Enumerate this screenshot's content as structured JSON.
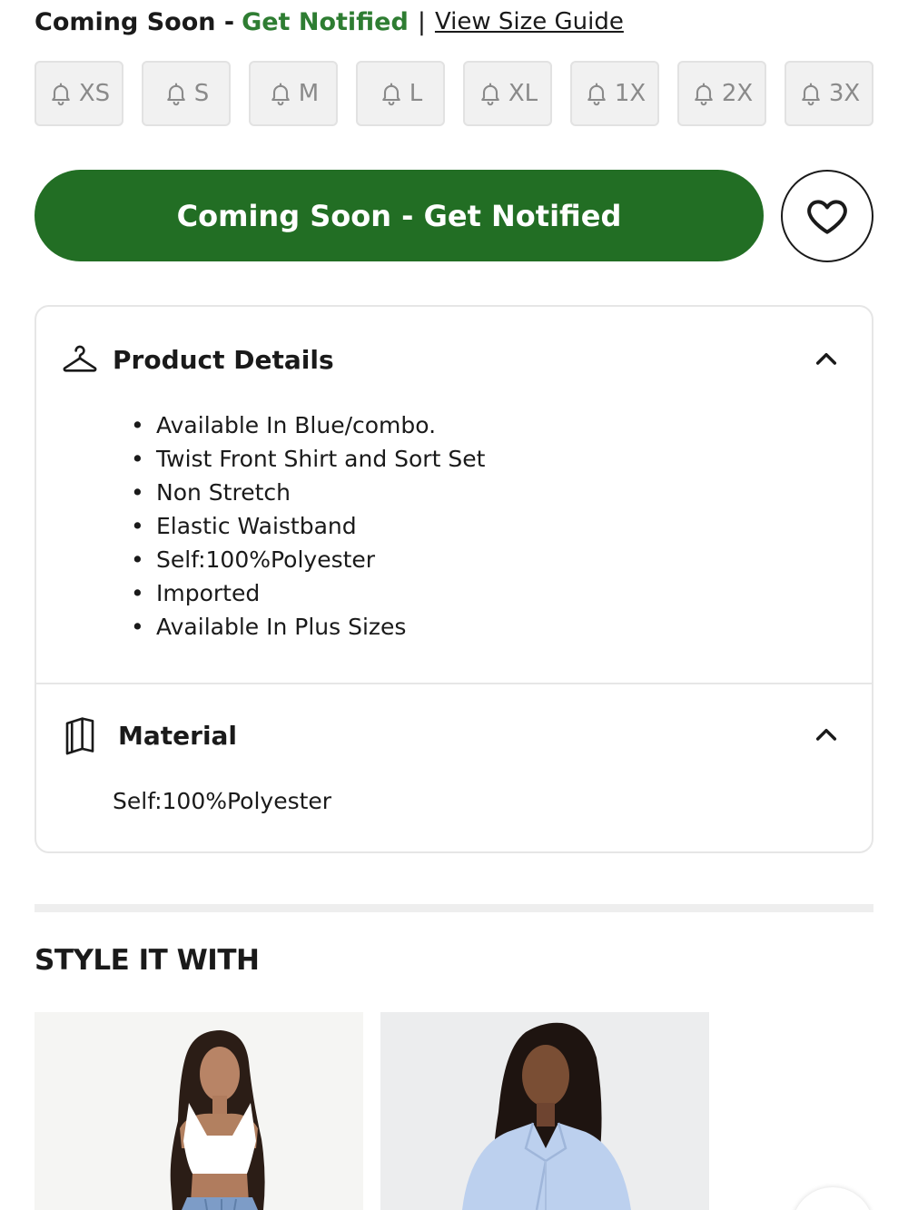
{
  "availability": {
    "coming_soon": "Coming Soon -",
    "get_notified": "Get Notified",
    "separator": "|",
    "size_guide": "View Size Guide"
  },
  "sizes": [
    "XS",
    "S",
    "M",
    "L",
    "XL",
    "1X",
    "2X",
    "3X"
  ],
  "cta": {
    "label": "Coming Soon - Get Notified",
    "color": "#226e24"
  },
  "product_details": {
    "title": "Product Details",
    "items": [
      "Available In Blue/combo.",
      "Twist Front Shirt and Sort Set",
      "Non Stretch",
      "Elastic Waistband",
      "Self:100%Polyester",
      "Imported",
      "Available In Plus Sizes"
    ]
  },
  "material": {
    "title": "Material",
    "text": "Self:100%Polyester"
  },
  "style_it_with": {
    "title": "STYLE IT WITH"
  },
  "colors": {
    "accent_green": "#2e7d32",
    "cta_green": "#226e24"
  },
  "icons": {
    "size_chip": "bell-icon",
    "wishlist": "heart-icon",
    "details": "hanger-icon",
    "material": "fabric-swatch-icon",
    "collapse": "chevron-up-icon"
  }
}
